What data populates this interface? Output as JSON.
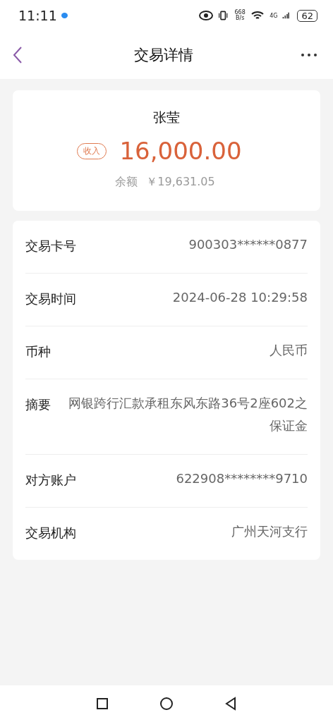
{
  "status_bar": {
    "time": "11:11",
    "net_speed": "668 B/s",
    "network": "4G",
    "battery": "62"
  },
  "header": {
    "title": "交易详情"
  },
  "summary": {
    "name": "张莹",
    "badge": "收入",
    "amount": "16,000.00",
    "balance_label": "余额",
    "balance": "￥19,631.05"
  },
  "details": [
    {
      "label": "交易卡号",
      "value": "900303******0877"
    },
    {
      "label": "交易时间",
      "value": "2024-06-28 10:29:58"
    },
    {
      "label": "币种",
      "value": "人民币"
    },
    {
      "label": "摘要",
      "value": "网银跨行汇款承租东风东路36号2座602之保证金"
    },
    {
      "label": "对方账户",
      "value": "622908********9710"
    },
    {
      "label": "交易机构",
      "value": "广州天河支行"
    }
  ]
}
